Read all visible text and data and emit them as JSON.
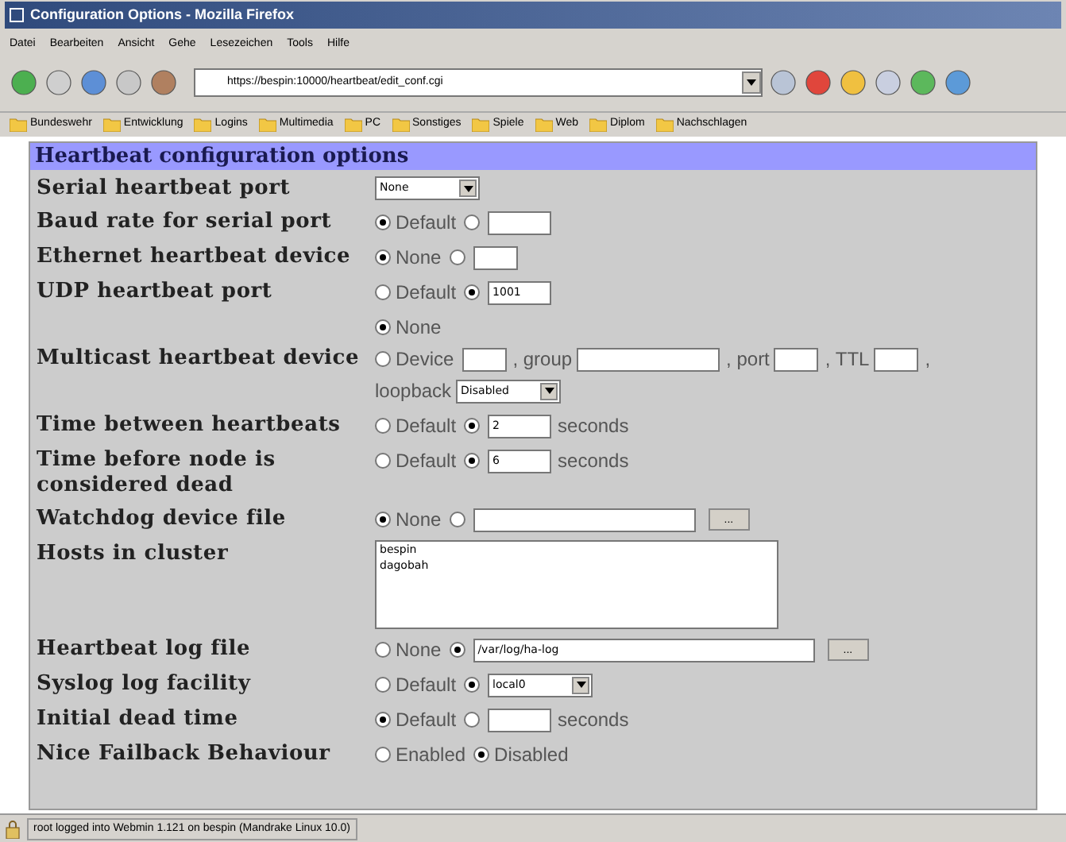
{
  "window": {
    "title": "Configuration Options - Mozilla Firefox"
  },
  "menu": [
    "Datei",
    "Bearbeiten",
    "Ansicht",
    "Gehe",
    "Lesezeichen",
    "Tools",
    "Hilfe"
  ],
  "address_bar": {
    "value": "https://bespin:10000/heartbeat/edit_conf.cgi"
  },
  "bookmarks": [
    "Bundeswehr",
    "Entwicklung",
    "Logins",
    "Multimedia",
    "PC",
    "Sonstiges",
    "Spiele",
    "Web",
    "Diplom",
    "Nachschlagen"
  ],
  "panel": {
    "title": "Heartbeat configuration options"
  },
  "rows": [
    {
      "label": "Serial heartbeat port",
      "parts": [
        {
          "kind": "select",
          "value": "None"
        }
      ]
    },
    {
      "label": "Baud rate for serial port",
      "parts": [
        {
          "kind": "radio",
          "label": "Default",
          "selected": true
        },
        {
          "kind": "radio",
          "selected": false
        },
        {
          "kind": "field_medium"
        }
      ]
    },
    {
      "label": "Ethernet heartbeat device",
      "parts": [
        {
          "kind": "radio",
          "label": "None",
          "selected": true
        },
        {
          "kind": "radio",
          "selected": false
        },
        {
          "kind": "field_small"
        }
      ]
    },
    {
      "label": "UDP heartbeat port",
      "parts": [
        {
          "kind": "radio",
          "label": "Default",
          "selected": false
        },
        {
          "kind": "radio",
          "selected": true
        },
        {
          "kind": "field_medium",
          "value": "1001"
        }
      ]
    },
    {
      "label": "Multicast heartbeat device",
      "parts": [
        {
          "kind": "radio",
          "label": "None",
          "selected": true
        },
        {
          "kind": "break"
        },
        {
          "kind": "radio",
          "label": "Device",
          "selected": false
        },
        {
          "kind": "field_small"
        },
        {
          "kind": "text",
          "text": ", group"
        },
        {
          "kind": "field_wide"
        },
        {
          "kind": "text",
          "text": ", port"
        },
        {
          "kind": "field_small"
        },
        {
          "kind": "text",
          "text": ", TTL"
        },
        {
          "kind": "field_small"
        },
        {
          "kind": "text",
          "text": ","
        },
        {
          "kind": "break"
        },
        {
          "kind": "text",
          "text": "loopback"
        },
        {
          "kind": "select",
          "value": "Disabled"
        }
      ]
    },
    {
      "label": "Time between heartbeats",
      "parts": [
        {
          "kind": "radio",
          "label": "Default",
          "selected": false
        },
        {
          "kind": "radio",
          "selected": true
        },
        {
          "kind": "field_medium",
          "value": "2"
        },
        {
          "kind": "text",
          "text": "seconds"
        }
      ]
    },
    {
      "label": "Time before node is considered dead",
      "parts": [
        {
          "kind": "radio",
          "label": "Default",
          "selected": false
        },
        {
          "kind": "radio",
          "selected": true
        },
        {
          "kind": "field_medium",
          "value": "6"
        },
        {
          "kind": "text",
          "text": "seconds"
        }
      ]
    },
    {
      "label": "Watchdog device file",
      "parts": [
        {
          "kind": "radio",
          "label": "None",
          "selected": true
        },
        {
          "kind": "radio",
          "selected": false
        },
        {
          "kind": "field_long"
        },
        {
          "kind": "browse",
          "label": "..."
        }
      ]
    },
    {
      "label": "Hosts in cluster",
      "parts": [
        {
          "kind": "textarea",
          "lines": [
            "bespin",
            "dagobah"
          ]
        }
      ]
    },
    {
      "label": "Heartbeat log file",
      "parts": [
        {
          "kind": "radio",
          "label": "None",
          "selected": false
        },
        {
          "kind": "radio",
          "selected": true
        },
        {
          "kind": "field_log",
          "value": "/var/log/ha-log"
        },
        {
          "kind": "browse",
          "label": "..."
        }
      ]
    },
    {
      "label": "Syslog log facility",
      "parts": [
        {
          "kind": "radio",
          "label": "Default",
          "selected": false
        },
        {
          "kind": "radio",
          "selected": true
        },
        {
          "kind": "select",
          "value": "local0"
        }
      ]
    },
    {
      "label": "Initial dead time",
      "parts": [
        {
          "kind": "radio",
          "label": "Default",
          "selected": true
        },
        {
          "kind": "radio",
          "selected": false
        },
        {
          "kind": "field_medium"
        },
        {
          "kind": "text",
          "text": "seconds"
        }
      ]
    },
    {
      "label": "Nice Failback Behaviour",
      "parts": [
        {
          "kind": "radio",
          "label": "Enabled",
          "selected": false
        },
        {
          "kind": "radio",
          "label": "Disabled",
          "selected": true
        }
      ]
    }
  ],
  "status_bar": {
    "text": "root logged into Webmin 1.121 on bespin (Mandrake Linux 10.0)"
  }
}
